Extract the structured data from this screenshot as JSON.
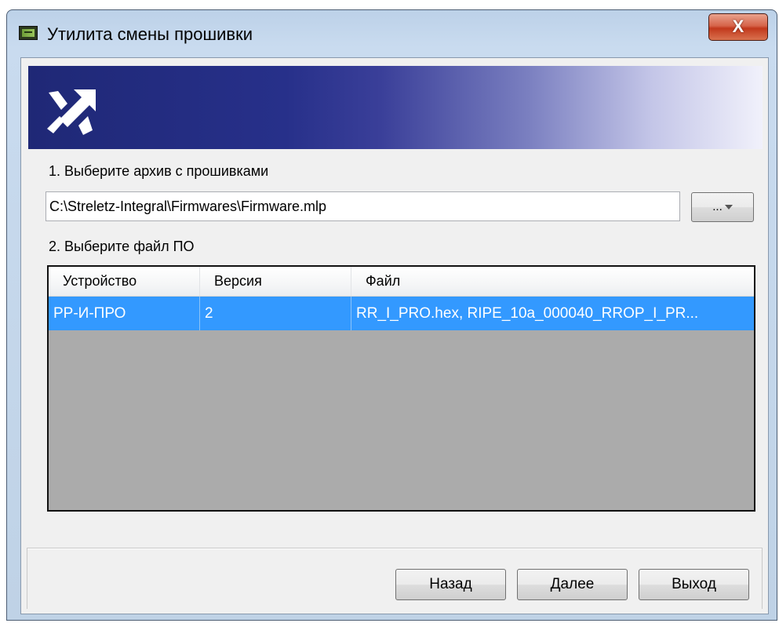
{
  "window": {
    "title": "Утилита смены прошивки",
    "close_label": "X"
  },
  "step1": {
    "label": "1. Выберите архив с прошивками",
    "path_value": "C:\\Streletz-Integral\\Firmwares\\Firmware.mlp",
    "browse_label": "..."
  },
  "step2": {
    "label": "2. Выберите файл ПО"
  },
  "table": {
    "columns": [
      "Устройство",
      "Версия",
      "Файл"
    ],
    "rows": [
      [
        "РР-И-ПРО",
        "2",
        "RR_I_PRO.hex, RIPE_10a_000040_RROP_I_PR..."
      ]
    ]
  },
  "footer": {
    "back_label": "Назад",
    "next_label": "Далее",
    "exit_label": "Выход"
  },
  "colors": {
    "selection": "#3399ff",
    "banner_start": "#1f2876",
    "empty_list": "#ababab"
  },
  "icons": [
    "app-chip-icon",
    "close-icon",
    "streletz-logo-icon",
    "dropdown-arrow-icon"
  ]
}
